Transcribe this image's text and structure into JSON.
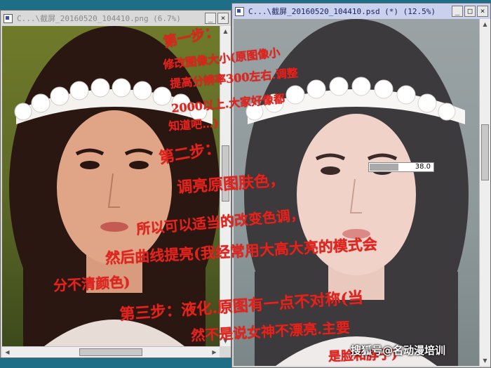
{
  "left_window": {
    "title": "C...\\截屏_20160520_104410.png (6.7%)",
    "controls": {
      "minimize": "_",
      "close": "×"
    }
  },
  "right_window": {
    "title": "C...\\截屏_20160520_104410.psd (*) (12.5%)",
    "controls": {
      "minimize": "_",
      "maximize": "□",
      "close": "×"
    },
    "slider": {
      "value": "38.0",
      "fill_fraction": 0.45
    }
  },
  "annotations": [
    "第一步：",
    "修改图像大小(原图像小",
    "提高分辨率300左右.调整",
    "2000以上.大家好像都",
    "知道吧…)",
    "第二步：",
    "调亮原图肤色，",
    "所以可以适当的改变色调，",
    "然后曲线提亮(我经常用大高大亮的模式会",
    "分不清颜色)",
    "第三步：液化.原图有一点不对称(当",
    "然不是说女神不漂亮.主要",
    "是脸和脖子)"
  ],
  "watermark": "搜狐号@名动漫培训"
}
